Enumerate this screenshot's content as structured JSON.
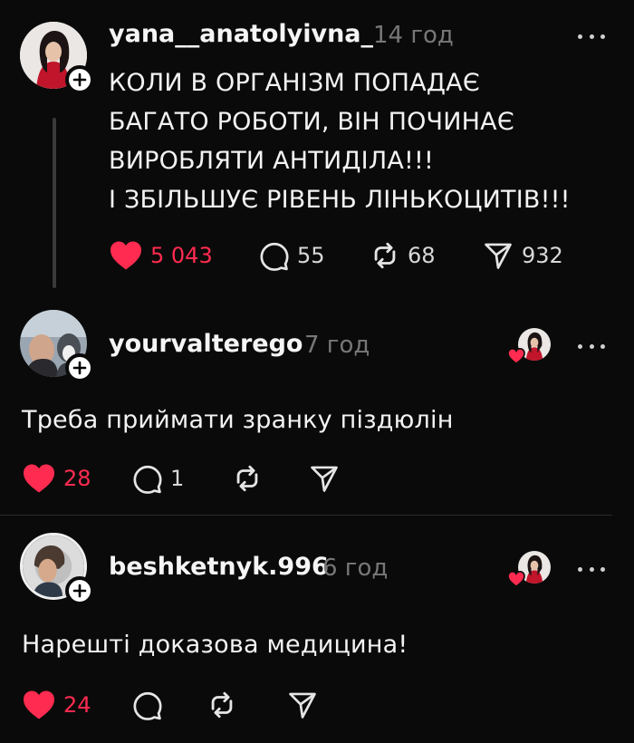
{
  "posts": [
    {
      "username": "yana__anatolyivna_",
      "time": "14 год",
      "text": "КОЛИ В ОРГАНІЗМ ПОПАДАЄ\nБАГАТО РОБОТИ, ВІН ПОЧИНАЄ\nВИРОБЛЯТИ АНТИДІЛА!!!\nІ ЗБІЛЬШУЄ РІВЕНЬ ЛІНЬКОЦИТІВ!!!",
      "likes": "5 043",
      "comments": "55",
      "reposts": "68",
      "shares": "932"
    },
    {
      "username": "yourvalterego",
      "time": "7 год",
      "text": "Треба приймати зранку піздюлін",
      "likes": "28",
      "comments": "1"
    },
    {
      "username": "beshketnyk.996",
      "time": "6 год",
      "text": "Нарешті доказова медицина!",
      "likes": "24"
    }
  ],
  "colors": {
    "background": "#0a0a0a",
    "like_red": "#ff2b50",
    "muted": "#777777",
    "divider": "#2b2b2b"
  },
  "icons": [
    "heart-filled-icon",
    "comment-bubble-icon",
    "repost-icon",
    "share-paper-plane-icon",
    "more-dots-icon",
    "follow-plus-icon"
  ]
}
